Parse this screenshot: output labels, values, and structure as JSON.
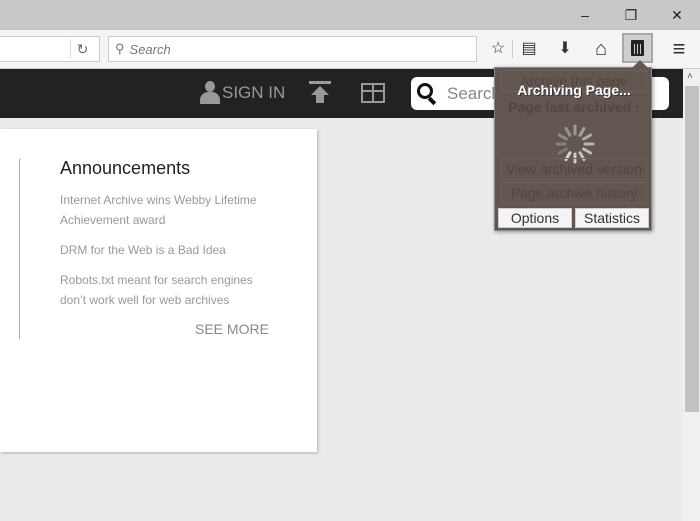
{
  "window": {
    "minimize": "–",
    "restore": "❐",
    "close": "✕"
  },
  "toolbar": {
    "reload_icon": "↻",
    "search_placeholder": "Search",
    "search_icon": "⚲",
    "star_icon": "☆",
    "reading_list_icon": "▤",
    "download_icon": "⬇",
    "home_icon": "⌂",
    "archive_icon": "🗑",
    "menu_icon": "≡"
  },
  "site": {
    "sign_in": "SIGN IN",
    "search_placeholder": "Search"
  },
  "announcements": {
    "title": "Announcements",
    "items": [
      "Internet Archive wins Webby Lifetime Achievement award",
      "DRM for the Web is a Bad Idea",
      "Robots.txt meant for search engines don’t work well for web archives"
    ],
    "see_more": "SEE MORE"
  },
  "popup": {
    "archive_this_page": "Archive this page",
    "status": "Archiving Page...",
    "last_archived": "Page last archived :",
    "view_archived": "View archived version",
    "history": "Page archive history",
    "options": "Options",
    "statistics": "Statistics"
  }
}
